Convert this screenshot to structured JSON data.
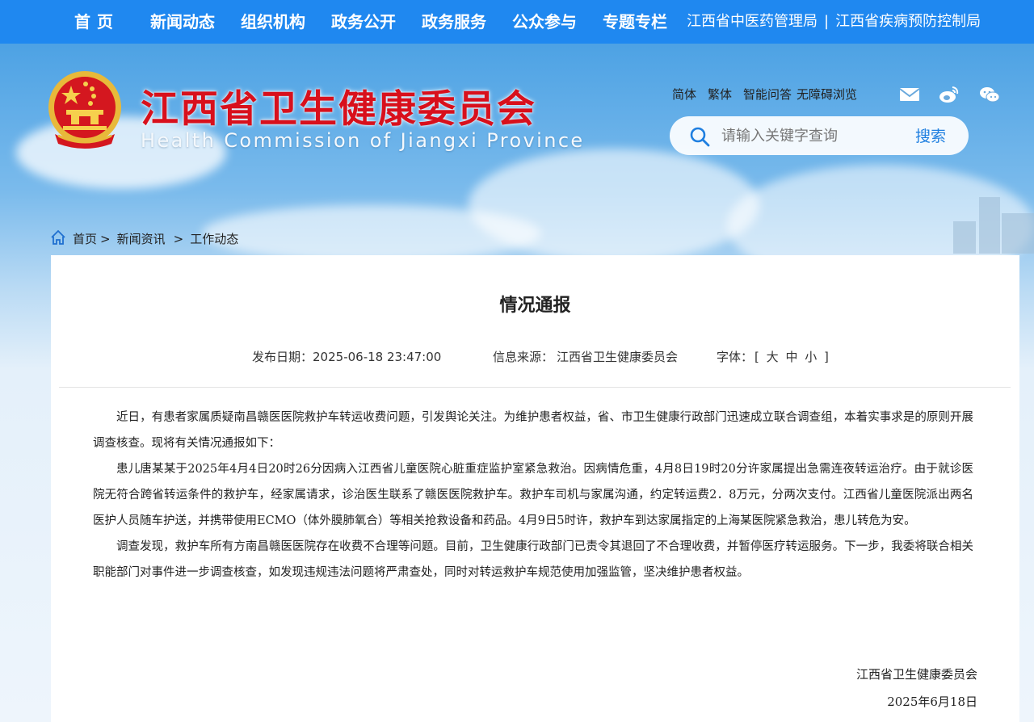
{
  "nav": {
    "home": "首页",
    "items": [
      "新闻动态",
      "组织机构",
      "政务公开",
      "政务服务",
      "公众参与",
      "专题专栏"
    ],
    "right_links": [
      "江西省中医药管理局",
      "江西省疾病预防控制局"
    ],
    "right_separator": "|"
  },
  "header": {
    "title": "江西省卫生健康委员会",
    "subtitle": "Health Commission of Jiangxi Province",
    "tools": [
      "简体",
      "繁体",
      "智能问答",
      "无障碍浏览"
    ],
    "icons": [
      "mail-icon",
      "weibo-icon",
      "wechat-icon"
    ]
  },
  "search": {
    "placeholder": "请输入关键字查询",
    "button": "搜索"
  },
  "breadcrumb": {
    "items": [
      "首页",
      "新闻资讯",
      "工作动态"
    ],
    "separator": ">"
  },
  "article": {
    "title": "情况通报",
    "date_label": "发布日期：",
    "date": "2025-06-18 23:47:00",
    "source_label": "信息来源：",
    "source": "江西省卫生健康委员会",
    "font_label": "字体：",
    "font_open": "[",
    "font_sizes": [
      "大",
      "中",
      "小"
    ],
    "font_close": "]",
    "paragraphs": [
      "近日，有患者家属质疑南昌赣医医院救护车转运收费问题，引发舆论关注。为维护患者权益，省、市卫生健康行政部门迅速成立联合调查组，本着实事求是的原则开展调查核查。现将有关情况通报如下：",
      "患儿唐某某于2025年4月4日20时26分因病入江西省儿童医院心脏重症监护室紧急救治。因病情危重，4月8日19时20分许家属提出急需连夜转运治疗。由于就诊医院无符合跨省转运条件的救护车，经家属请求，诊治医生联系了赣医医院救护车。救护车司机与家属沟通，约定转运费2．8万元，分两次支付。江西省儿童医院派出两名医护人员随车护送，并携带使用ECMO（体外膜肺氧合）等相关抢救设备和药品。4月9日5时许，救护车到达家属指定的上海某医院紧急救治，患儿转危为安。",
      "调查发现，救护车所有方南昌赣医医院存在收费不合理等问题。目前，卫生健康行政部门已责令其退回了不合理收费，并暂停医疗转运服务。下一步，我委将联合相关职能部门对事件进一步调查核查，如发现违规违法问题将严肃查处，同时对转运救护车规范使用加强监管，坚决维护患者权益。"
    ],
    "signature": "江西省卫生健康委员会",
    "signature_date": "2025年6月18日"
  },
  "colors": {
    "nav_bg": "#1f88f0",
    "title_red": "#d8101c",
    "search_blue": "#1f7fe0"
  }
}
